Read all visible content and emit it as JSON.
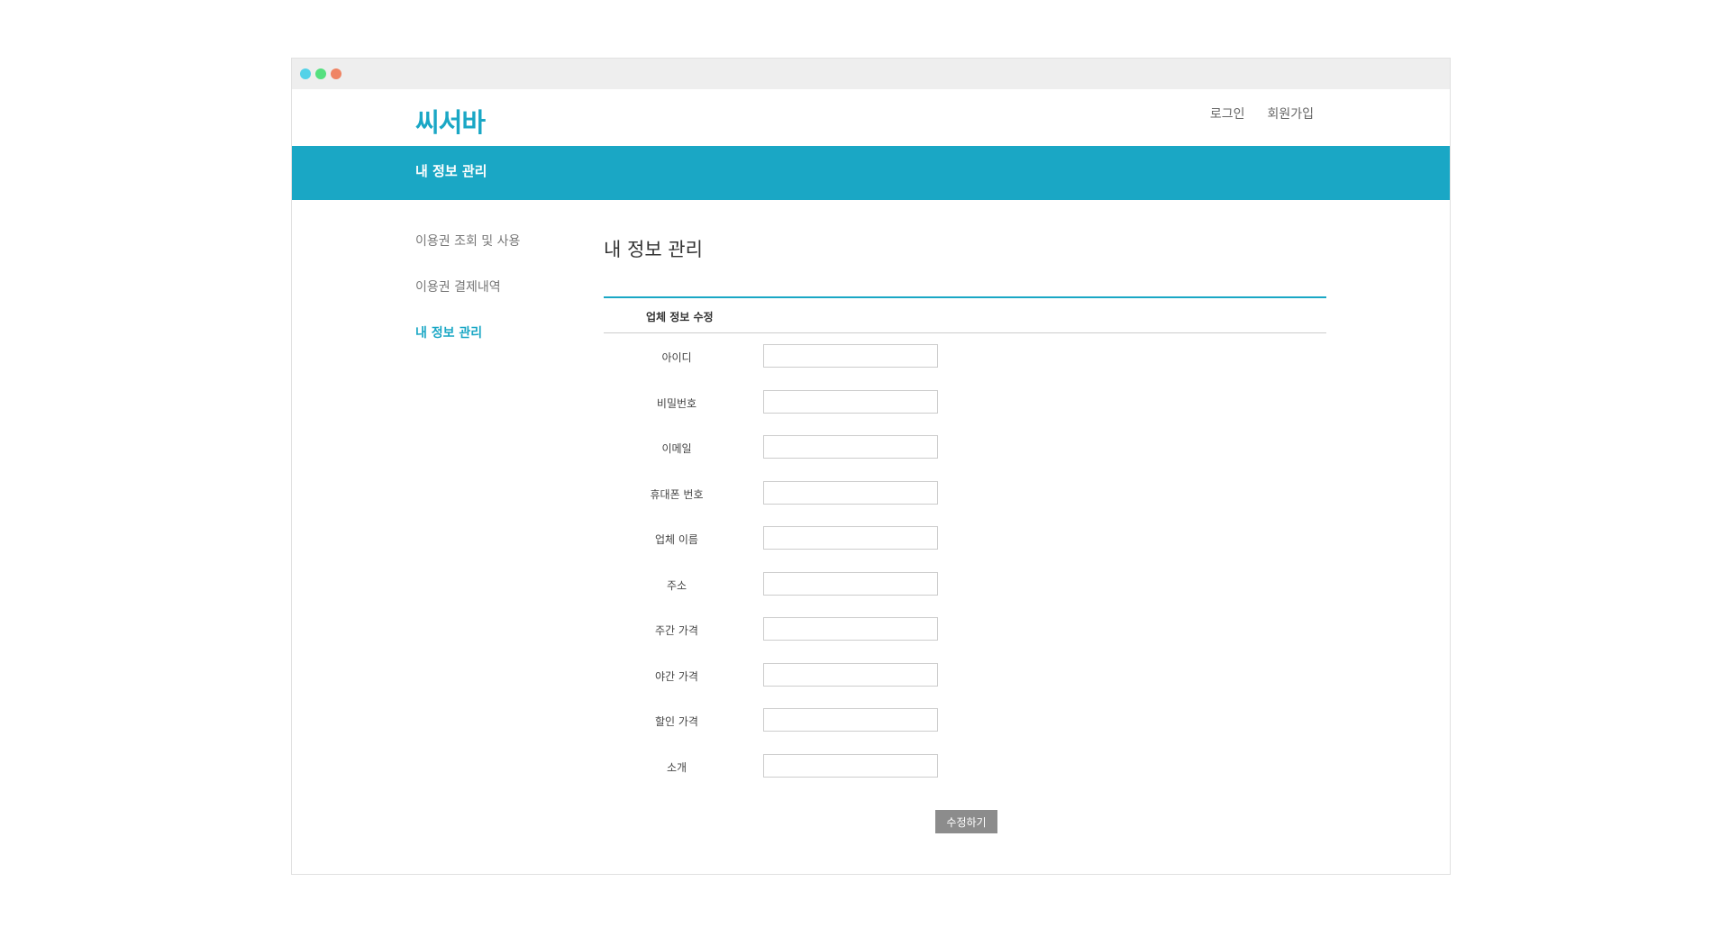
{
  "colors": {
    "accent": "#1aa7c5",
    "window_dot_1": "#54d2e8",
    "window_dot_2": "#54e07f",
    "window_dot_3": "#ef8464",
    "button_bg": "#8c8c8c"
  },
  "window": {
    "dots": [
      "blue-dot-icon",
      "green-dot-icon",
      "orange-dot-icon"
    ]
  },
  "header": {
    "logo": "씨서바",
    "login": "로그인",
    "signup": "회원가입"
  },
  "banner": {
    "title": "내 정보 관리"
  },
  "sidebar": {
    "items": [
      {
        "label": "이용권 조회 및 사용",
        "active": false
      },
      {
        "label": "이용권 결제내역",
        "active": false
      },
      {
        "label": "내 정보 관리",
        "active": true
      }
    ]
  },
  "main": {
    "title": "내 정보 관리",
    "section_title": "업체 정보 수정",
    "fields": [
      {
        "label": "아이디",
        "value": "",
        "placeholder": ""
      },
      {
        "label": "비밀번호",
        "value": "",
        "placeholder": ""
      },
      {
        "label": "이메일",
        "value": "",
        "placeholder": ""
      },
      {
        "label": "휴대폰 번호",
        "value": "",
        "placeholder": ""
      },
      {
        "label": "업체 이름",
        "value": "",
        "placeholder": ""
      },
      {
        "label": "주소",
        "value": "",
        "placeholder": ""
      },
      {
        "label": "주간 가격",
        "value": "",
        "placeholder": ""
      },
      {
        "label": "야간 가격",
        "value": "",
        "placeholder": ""
      },
      {
        "label": "할인 가격",
        "value": "",
        "placeholder": ""
      },
      {
        "label": "소개",
        "value": "",
        "placeholder": ""
      }
    ],
    "submit_label": "수정하기"
  }
}
